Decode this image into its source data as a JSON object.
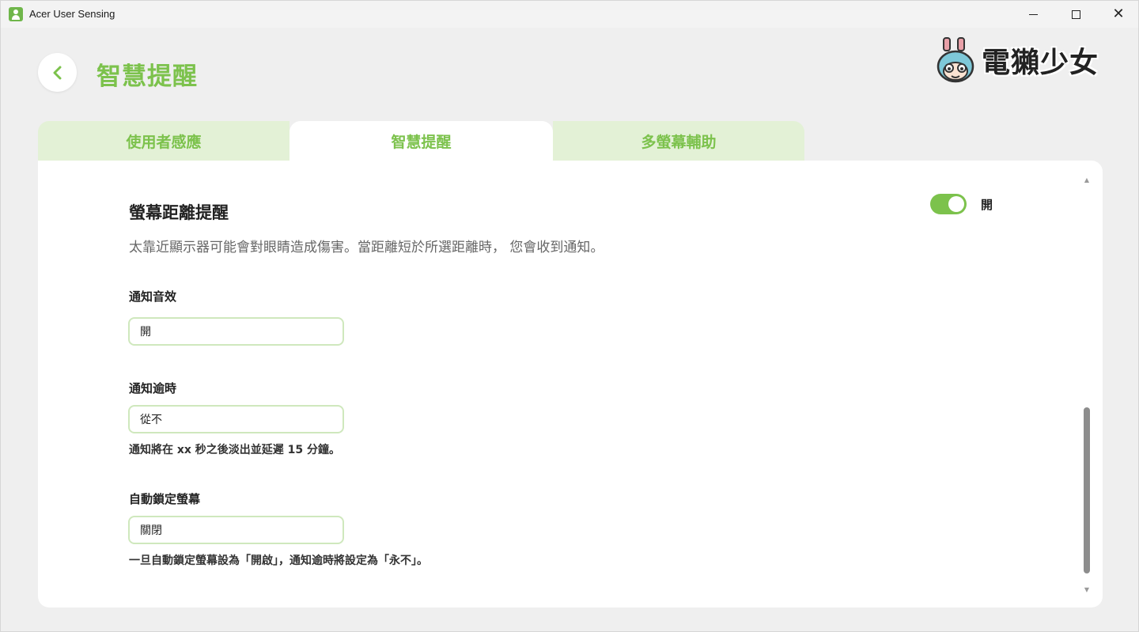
{
  "window": {
    "title": "Acer User Sensing",
    "controls": {
      "minimize": "minimize",
      "maximize": "maximize",
      "close": "close"
    }
  },
  "header": {
    "title": "智慧提醒",
    "logo_text": "電獺少女"
  },
  "tabs": [
    {
      "label": "使用者感應",
      "active": false
    },
    {
      "label": "智慧提醒",
      "active": true
    },
    {
      "label": "多螢幕輔助",
      "active": false
    }
  ],
  "section": {
    "title": "螢幕距離提醒",
    "description": "太靠近顯示器可能會對眼睛造成傷害。當距離短於所選距離時， 您會收到通知。",
    "toggle": {
      "on": true,
      "label": "開"
    }
  },
  "fields": {
    "sound": {
      "label": "通知音效",
      "value": "開"
    },
    "timeout": {
      "label": "通知逾時",
      "value": "從不",
      "hint": "通知將在 xx 秒之後淡出並延遲 15 分鐘。"
    },
    "autolock": {
      "label": "自動鎖定螢幕",
      "value": "關閉",
      "hint": "一旦自動鎖定螢幕設為「開啟」，通知逾時將設定為「永不」。"
    }
  },
  "colors": {
    "accent": "#7cc24c",
    "tab_inactive_bg": "#e3f1d6",
    "field_border": "#cfe8bd",
    "window_bg": "#efefef"
  }
}
